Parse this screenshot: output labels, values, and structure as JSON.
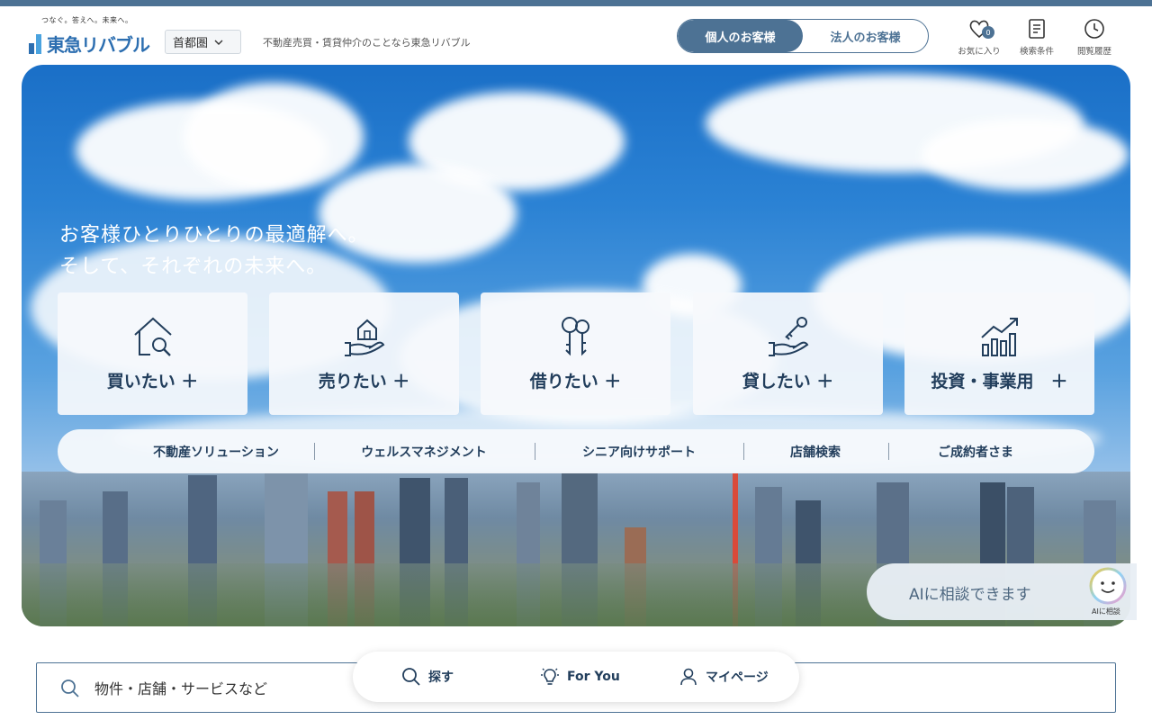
{
  "header": {
    "logo_tagline": "つなぐ。答えへ。未来へ。",
    "logo_text": "東急リバブル",
    "region_select": "首都圏",
    "tagline": "不動産売買・賃貸仲介のことなら東急リバブル",
    "segments": [
      "個人のお客様",
      "法人のお客様"
    ],
    "favorites_label": "お気に入り",
    "favorites_count": "0",
    "search_conditions_label": "検索条件",
    "history_label": "閲覧履歴",
    "accent_color": "#4d7294"
  },
  "hero": {
    "headline_line1": "お客様ひとりひとりの最適解へ。",
    "headline_line2": "そして、それぞれの未来へ。",
    "cards": [
      {
        "label": "買いたい ＋",
        "icon": "house-search-icon"
      },
      {
        "label": "売りたい ＋",
        "icon": "hand-house-icon"
      },
      {
        "label": "借りたい ＋",
        "icon": "keys-icon"
      },
      {
        "label": "貸したい ＋",
        "icon": "hand-key-icon"
      },
      {
        "label": "投資・事業用　＋",
        "icon": "growth-chart-icon"
      }
    ],
    "subnav": [
      "不動産ソリューション",
      "ウェルスマネジメント",
      "シニア向けサポート",
      "店舗検索",
      "ご成約者さま"
    ]
  },
  "ai": {
    "bubble_text": "AIに相談できます",
    "label": "AIに相談"
  },
  "search": {
    "placeholder": "物件・店舗・サービスなど"
  },
  "bottom_nav": {
    "search_label": "探す",
    "foryou_label": "For You",
    "mypage_label": "マイページ"
  }
}
